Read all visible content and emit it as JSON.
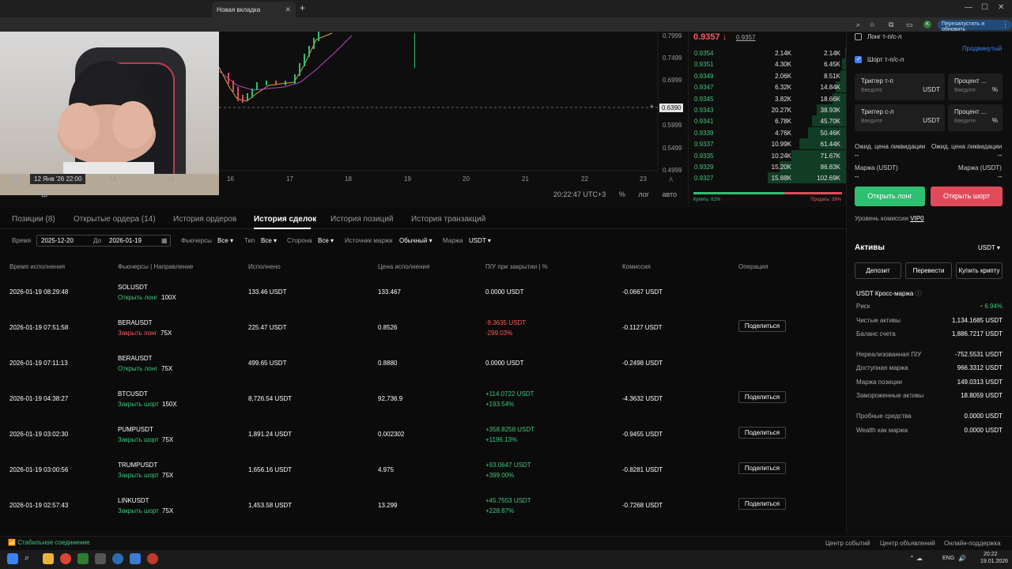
{
  "browser": {
    "tab_title": "Новая вкладка",
    "relaunch": "Перезапустить и обновить",
    "avatar": "K"
  },
  "chart": {
    "price_labels": [
      "0.7999",
      "0.7499",
      "0.6999",
      "0.6390",
      "0.5999",
      "0.5499",
      "0.4999"
    ],
    "current_price": "0.6390",
    "x_labels": [
      "14",
      "15",
      "16",
      "17",
      "18",
      "19",
      "20",
      "21",
      "22",
      "23"
    ],
    "date_label": "12 Янв '26  22:00",
    "clock": "20:22:47 UTC+3",
    "pct": "%",
    "log": "лог",
    "auto": "авто"
  },
  "orderbook": {
    "last_price": "0.9357",
    "arrow": "↓",
    "mark_price": "0.9357",
    "rows": [
      {
        "price": "0.9354",
        "amount": "2.14K",
        "total": "2.14K",
        "depth": 0.02
      },
      {
        "price": "0.9351",
        "amount": "4.30K",
        "total": "6.45K",
        "depth": 0.06
      },
      {
        "price": "0.9349",
        "amount": "2.06K",
        "total": "8.51K",
        "depth": 0.08
      },
      {
        "price": "0.9347",
        "amount": "6.32K",
        "total": "14.84K",
        "depth": 0.14
      },
      {
        "price": "0.9345",
        "amount": "3.82K",
        "total": "18.66K",
        "depth": 0.18
      },
      {
        "price": "0.9343",
        "amount": "20.27K",
        "total": "38.93K",
        "depth": 0.38
      },
      {
        "price": "0.9341",
        "amount": "6.78K",
        "total": "45.70K",
        "depth": 0.44
      },
      {
        "price": "0.9339",
        "amount": "4.76K",
        "total": "50.46K",
        "depth": 0.49
      },
      {
        "price": "0.9337",
        "amount": "10.99K",
        "total": "61.44K",
        "depth": 0.6
      },
      {
        "price": "0.9335",
        "amount": "10.24K",
        "total": "71.67K",
        "depth": 0.7
      },
      {
        "price": "0.9329",
        "amount": "15.20K",
        "total": "86.83K",
        "depth": 0.85
      },
      {
        "price": "0.9327",
        "amount": "15.88K",
        "total": "102.69K",
        "depth": 1.0
      }
    ],
    "buy_label": "Купить: 61%",
    "sell_label": "Продать: 39%",
    "buy_ratio": 0.61
  },
  "form": {
    "long_tpsl": "Лонг т-п/с-л",
    "short_tpsl": "Шорт т-п/с-л",
    "advanced": "Продвинутый",
    "trigger_tp": "Триггер т-п",
    "trigger_sl": "Триггер с-л",
    "percent": "Процент ...",
    "placeholder": "Введите",
    "unit_usdt": "USDT",
    "unit_pct": "%",
    "est_liq": "Ожид. цена ликвидации",
    "dash": "--",
    "margin": "Маржа (USDT)",
    "open_long": "Открыть лонг",
    "open_short": "Открыть шорт",
    "fee_level_label": "Уровень комиссии",
    "fee_level": "VIP0"
  },
  "tabs": [
    "Позиции (8)",
    "Открытые ордера (14)",
    "История ордеров",
    "История сделок",
    "История позиций",
    "История транзакций"
  ],
  "filters": {
    "time_label": "Время",
    "from": "2025-12-20",
    "to_label": "До",
    "to": "2026-01-19",
    "futures_label": "Фьючерсы",
    "futures": "Все",
    "type_label": "Тип",
    "type": "Все",
    "side_label": "Сторона",
    "side": "Все",
    "margin_src_label": "Источник маржи",
    "margin_src": "Обычный",
    "margin_label": "Маржа",
    "margin": "USDT"
  },
  "table": {
    "headers": [
      "Время исполнения",
      "Фьючерсы | Направление",
      "Исполнено",
      "Цена исполнения",
      "П/У при закрытии | %",
      "Комиссия",
      "Операция"
    ],
    "share": "Поделиться",
    "rows": [
      {
        "time": "2026-01-19 08:29:48",
        "sym": "SOLUSDT",
        "dir": "Открыть лонг",
        "lev": "100X",
        "filled": "133.46  USDT",
        "price": "133.467",
        "pnl": "0.0000  USDT",
        "pct": "",
        "fee": "-0.0667 USDT",
        "share": false,
        "dircls": "g",
        "pnlcls": ""
      },
      {
        "time": "2026-01-19 07:51:58",
        "sym": "BERAUSDT",
        "dir": "Закрыть лонг",
        "lev": "75X",
        "filled": "225.47  USDT",
        "price": "0.8526",
        "pnl": "-9.3635  USDT",
        "pct": "-299.03%",
        "fee": "-0.1127 USDT",
        "share": true,
        "dircls": "r",
        "pnlcls": "r"
      },
      {
        "time": "2026-01-19 07:11:13",
        "sym": "BERAUSDT",
        "dir": "Открыть лонг",
        "lev": "75X",
        "filled": "499.65  USDT",
        "price": "0.8880",
        "pnl": "0.0000  USDT",
        "pct": "",
        "fee": "-0.2498 USDT",
        "share": false,
        "dircls": "g",
        "pnlcls": ""
      },
      {
        "time": "2026-01-19 04:38:27",
        "sym": "BTCUSDT",
        "dir": "Закрыть шорт",
        "lev": "150X",
        "filled": "8,726.54  USDT",
        "price": "92,736.9",
        "pnl": "+114.0722  USDT",
        "pct": "+193.54%",
        "fee": "-4.3632 USDT",
        "share": true,
        "dircls": "g",
        "pnlcls": "g"
      },
      {
        "time": "2026-01-19 03:02:30",
        "sym": "PUMPUSDT",
        "dir": "Закрыть шорт",
        "lev": "75X",
        "filled": "1,891.24  USDT",
        "price": "0.002302",
        "pnl": "+358.8258  USDT",
        "pct": "+1196.13%",
        "fee": "-0.9455 USDT",
        "share": true,
        "dircls": "g",
        "pnlcls": "g"
      },
      {
        "time": "2026-01-19 03:00:56",
        "sym": "TRUMPUSDT",
        "dir": "Закрыть шорт",
        "lev": "75X",
        "filled": "1,656.16  USDT",
        "price": "4.975",
        "pnl": "+93.0647  USDT",
        "pct": "+399.00%",
        "fee": "-0.8281 USDT",
        "share": true,
        "dircls": "g",
        "pnlcls": "g"
      },
      {
        "time": "2026-01-19 02:57:43",
        "sym": "LINKUSDT",
        "dir": "Закрыть шорт",
        "lev": "75X",
        "filled": "1,453.58  USDT",
        "price": "13.299",
        "pnl": "+45.7553  USDT",
        "pct": "+228.87%",
        "fee": "-0.7268 USDT",
        "share": true,
        "dircls": "g",
        "pnlcls": "g"
      }
    ]
  },
  "assets": {
    "title": "Активы",
    "currency": "USDT",
    "deposit": "Депозит",
    "transfer": "Перевести",
    "buy_crypto": "Купить крипту",
    "cross": "USDT Кросс-маржа",
    "risk_label": "Риск",
    "risk": "6.94%",
    "rows": [
      {
        "k": "Чистые активы",
        "v": "1,134.1685 USDT"
      },
      {
        "k": "Баланс счета",
        "v": "1,886.7217 USDT"
      },
      {
        "k": "Нереализованная П/У",
        "v": "-752.5531 USDT"
      },
      {
        "k": "Доступная маржа",
        "v": "966.3312 USDT"
      },
      {
        "k": "Маржа позиции",
        "v": "149.0313 USDT"
      },
      {
        "k": "Замороженные активы",
        "v": "18.8059 USDT"
      },
      {
        "k": "Пробные средства",
        "v": "0.0000 USDT"
      },
      {
        "k": "Wealth как маржа",
        "v": "0.0000 USDT"
      }
    ]
  },
  "status": {
    "conn": "Стабильное соединение",
    "events": "Центр событий",
    "ads": "Центр объявлений",
    "support": "Онлайн-поддержка"
  },
  "taskbar": {
    "lang": "ENG",
    "time": "20:22",
    "date": "19.01.2026"
  }
}
